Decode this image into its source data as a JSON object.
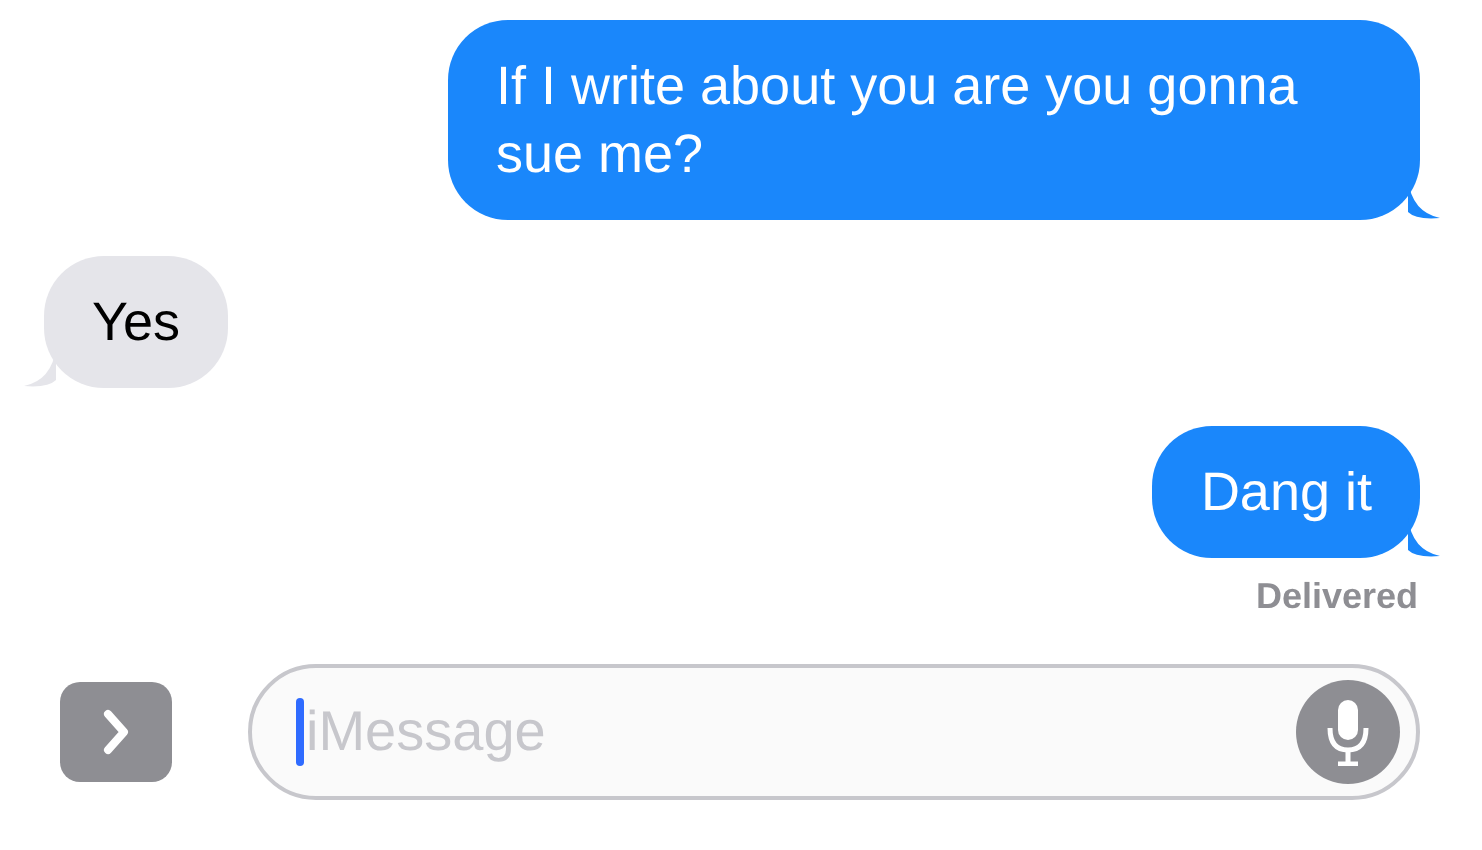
{
  "messages": [
    {
      "text": "If I write about you are you gonna sue me?",
      "kind": "sent"
    },
    {
      "text": "Yes",
      "kind": "received"
    },
    {
      "text": "Dang it",
      "kind": "sent"
    }
  ],
  "status": "Delivered",
  "composer": {
    "placeholder": "iMessage"
  }
}
